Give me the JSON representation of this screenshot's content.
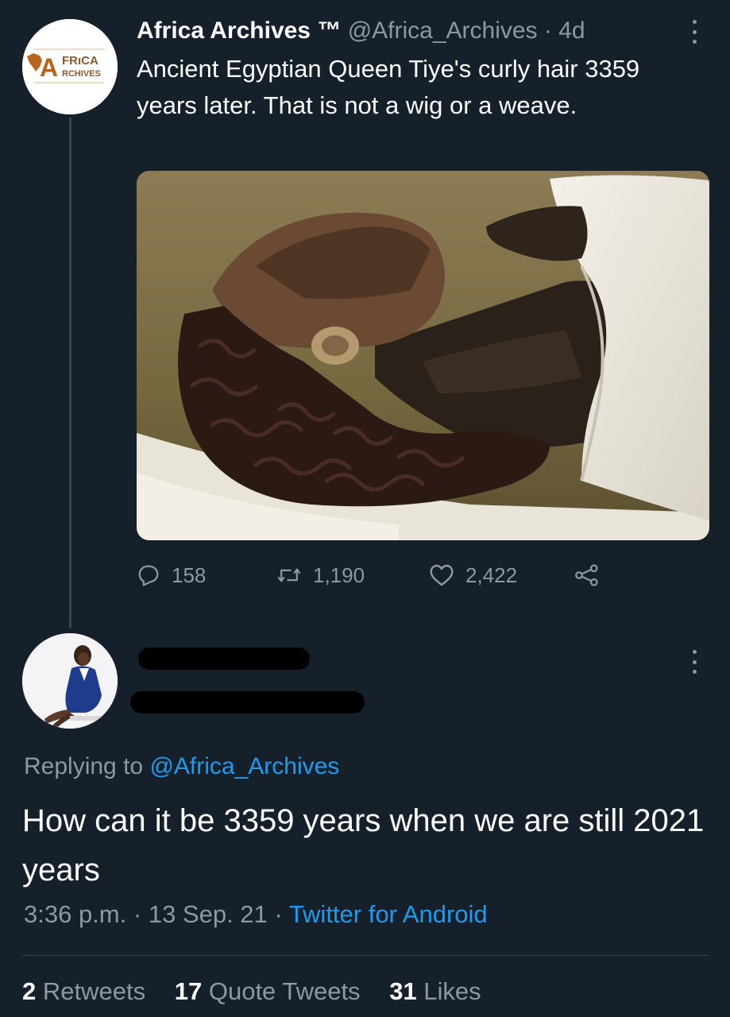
{
  "tweet": {
    "author": {
      "display_name": "Africa Archives ™",
      "handle": "@Africa_Archives",
      "separator": "·",
      "age": "4d",
      "avatar_logo": {
        "line1": "FRıCA",
        "line2": "RCHIVES",
        "initial": "A"
      }
    },
    "text": "Ancient Egyptian Queen Tiye's curly hair 3359 years later. That is not a wig or a weave.",
    "actions": {
      "replies": "158",
      "retweets": "1,190",
      "likes": "2,422"
    },
    "icons": {
      "reply": "reply-icon",
      "retweet": "retweet-icon",
      "like": "heart-icon",
      "share": "share-icon",
      "more": "more-vertical-icon"
    }
  },
  "reply": {
    "replying_label": "Replying to",
    "replying_handle": "@Africa_Archives",
    "text": "How can it be 3359 years when we are still 2021 years",
    "time": "3:36 p.m.",
    "date": "13 Sep. 21",
    "separator": "·",
    "source": "Twitter for Android",
    "stats": {
      "retweets_count": "2",
      "retweets_label": "Retweets",
      "quotes_count": "17",
      "quotes_label": "Quote Tweets",
      "likes_count": "31",
      "likes_label": "Likes"
    }
  },
  "colors": {
    "background": "#15202b",
    "secondary_text": "#8b98a5",
    "link": "#1d9bf0",
    "divider": "#38444d",
    "logo_brown": "#b5651d"
  }
}
